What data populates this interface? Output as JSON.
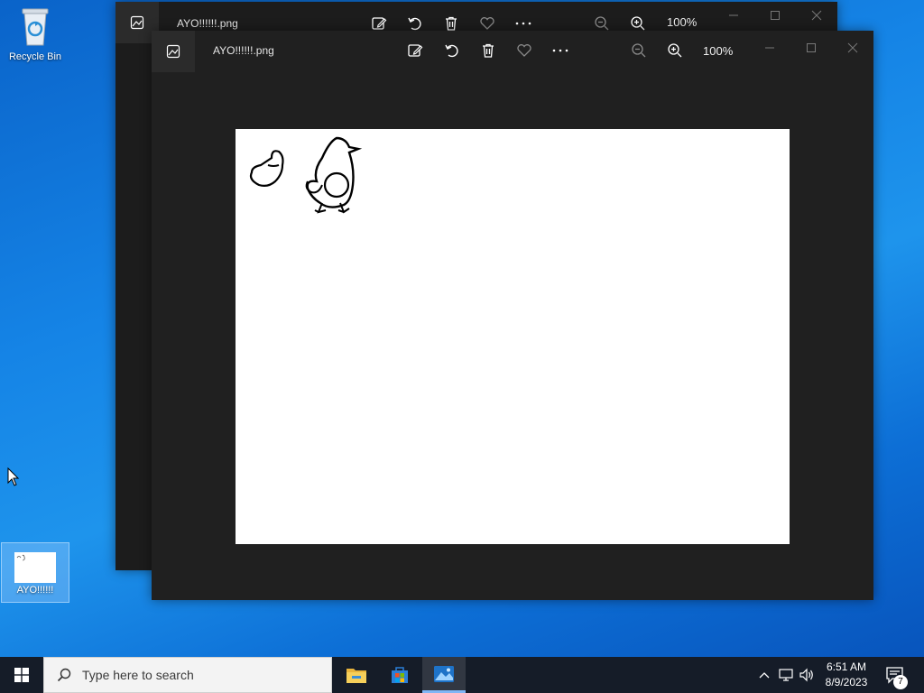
{
  "desktop": {
    "recycle_bin_label": "Recycle Bin",
    "file_icon_label": "AYO!!!!!!"
  },
  "windows": {
    "back": {
      "file_name": "AYO!!!!!!.png",
      "zoom": "100%"
    },
    "front": {
      "file_name": "AYO!!!!!!.png",
      "zoom": "100%"
    }
  },
  "toolbar_icons": [
    "edit-image-icon",
    "rotate-icon",
    "delete-icon",
    "favorite-icon",
    "more-icon",
    "zoom-out-icon",
    "zoom-in-icon"
  ],
  "caption_icons": [
    "minimize-icon",
    "maximize-icon",
    "close-icon"
  ],
  "taskbar": {
    "search_placeholder": "Type here to search",
    "apps": [
      "file-explorer-icon",
      "microsoft-store-icon",
      "photos-icon"
    ],
    "time": "6:51 AM",
    "date": "8/9/2023",
    "notification_count": "7"
  },
  "colors": {
    "window_bg": "#202020",
    "taskbar_bg": "#151c28",
    "accent": "#7fb6f5"
  }
}
